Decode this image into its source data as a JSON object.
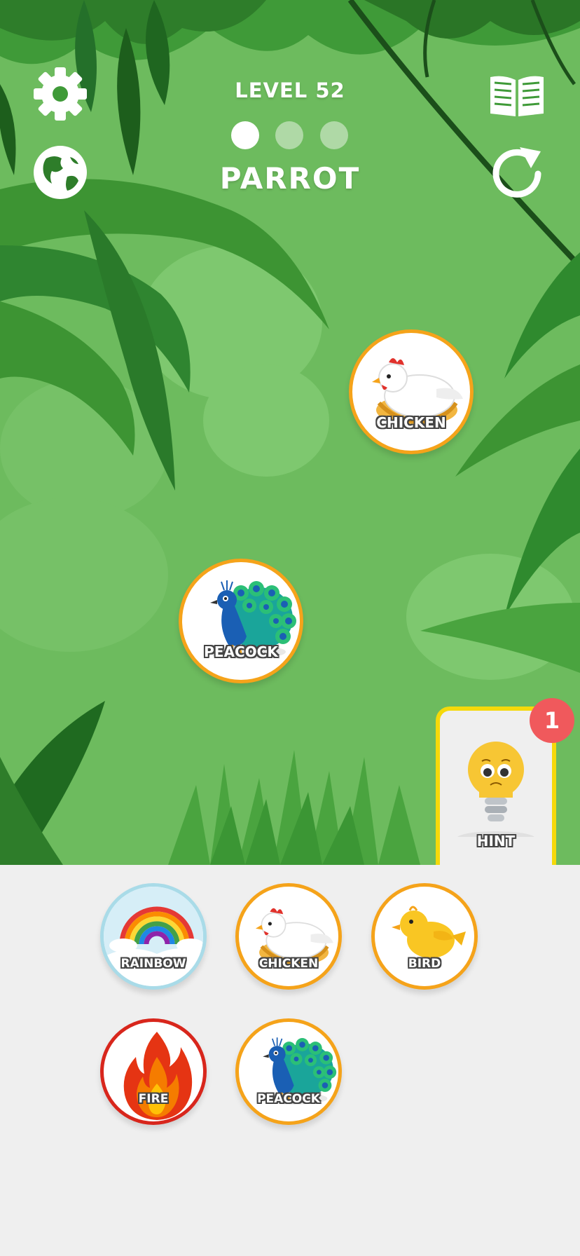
{
  "header": {
    "level_label": "LEVEL 52",
    "target_word": "PARROT",
    "progress_dots": {
      "total": 3,
      "filled": 1
    }
  },
  "toolbar": {
    "settings_icon": "gear-icon",
    "language_icon": "globe-icon",
    "book_icon": "book-icon",
    "restart_icon": "restart-icon"
  },
  "board": {
    "tokens": [
      {
        "label": "CHICKEN",
        "icon": "chicken-icon"
      },
      {
        "label": "PEACOCK",
        "icon": "peacock-icon"
      }
    ]
  },
  "tray": {
    "tokens": [
      {
        "label": "RAINBOW",
        "icon": "rainbow-icon"
      },
      {
        "label": "CHICKEN",
        "icon": "chicken-icon"
      },
      {
        "label": "BIRD",
        "icon": "bird-icon"
      },
      {
        "label": "FIRE",
        "icon": "fire-icon"
      },
      {
        "label": "PEACOCK",
        "icon": "peacock-icon"
      }
    ]
  },
  "hint": {
    "label": "HINT",
    "count": "1",
    "icon": "lightbulb-icon"
  },
  "colors": {
    "jungle_bg": "#6dbb5e",
    "token_border": "#f5a31a",
    "rainbow_border": "#a9dbe8",
    "fire_border": "#d8261c",
    "hint_border": "#f5d90a",
    "badge": "#f0595c",
    "tray_bg": "#efefef"
  }
}
